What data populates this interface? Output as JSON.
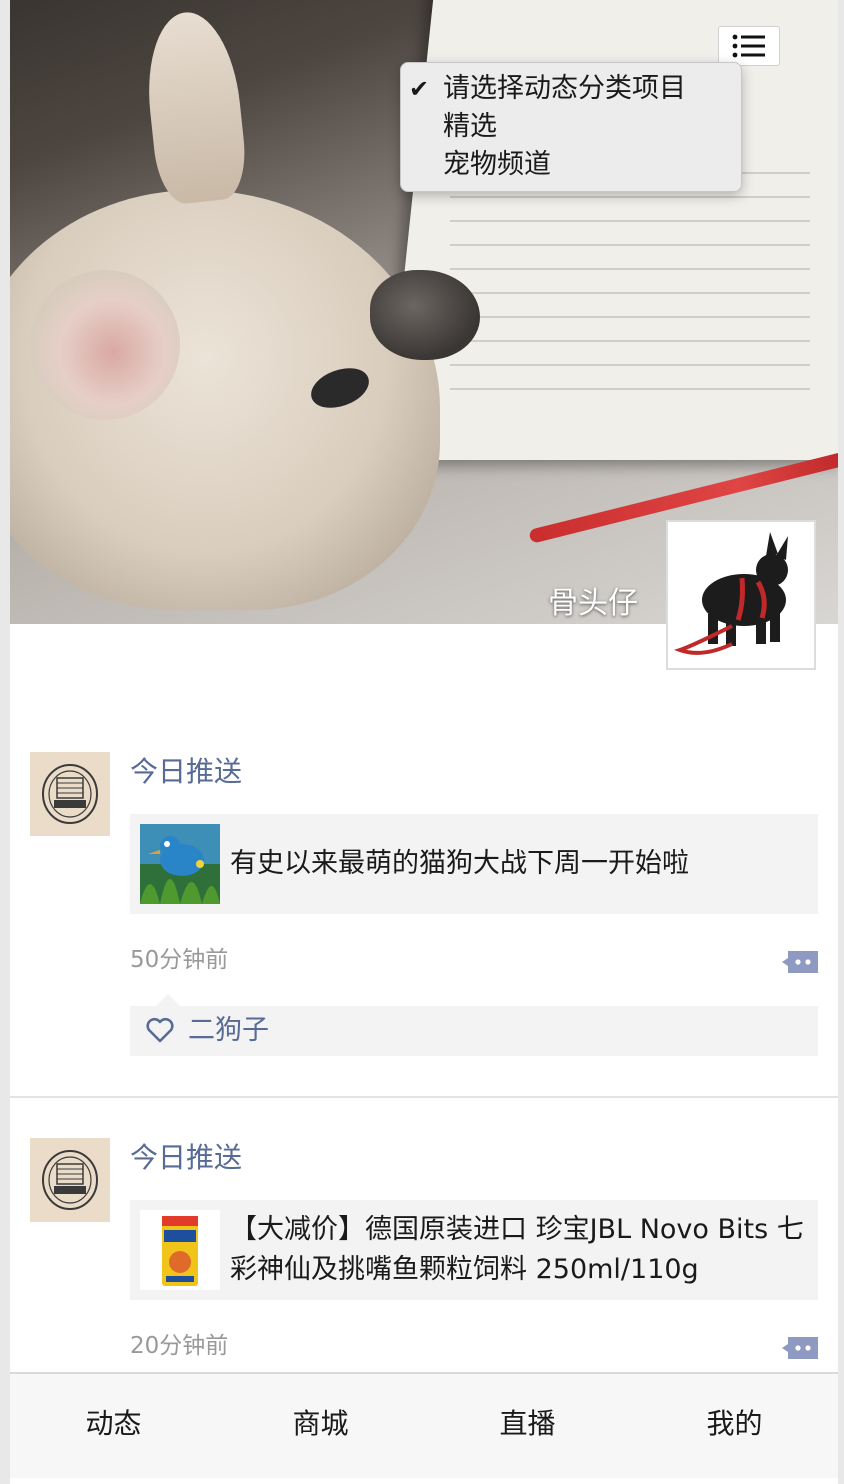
{
  "header": {
    "owner_name": "骨头仔",
    "menu_icon": "list-icon"
  },
  "category_menu": {
    "selected_index": 0,
    "options": [
      "请选择动态分类项目",
      "精选",
      "宠物频道"
    ]
  },
  "posts": [
    {
      "author": "今日推送",
      "share_title": "有史以来最萌的猫狗大战下周一开始啦",
      "time": "50分钟前",
      "likes": [
        "二狗子"
      ]
    },
    {
      "author": "今日推送",
      "share_title": "【大减价】德国原装进口 珍宝JBL Novo Bits 七彩神仙及挑嘴鱼颗粒饲料 250ml/110g",
      "time": "20分钟前",
      "likes": []
    }
  ],
  "tabbar": {
    "items": [
      "动态",
      "商城",
      "直播",
      "我的"
    ]
  },
  "colors": {
    "link": "#576b95",
    "time": "#999999",
    "card_bg": "#f3f3f3"
  }
}
